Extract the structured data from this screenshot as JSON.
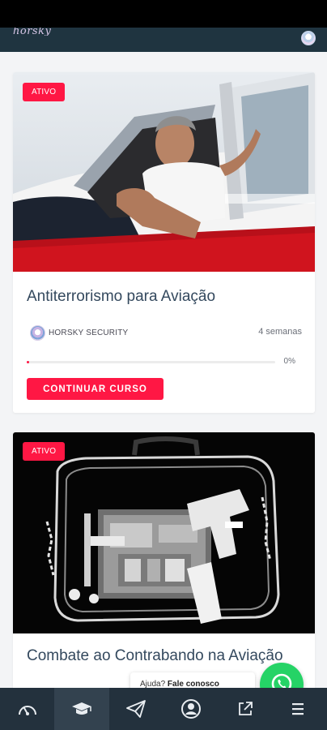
{
  "header": {
    "logo_text": "horsky"
  },
  "courses": [
    {
      "badge": "ATIVO",
      "title": "Antiterrorismo para Aviação",
      "author": "HORSKY SECURITY",
      "duration": "4 semanas",
      "progress_label": "0%",
      "progress": 0.01,
      "button_label": "CONTINUAR CURSO"
    },
    {
      "badge": "ATIVO",
      "title": "Combate ao Contrabando na Aviação"
    }
  ],
  "help": {
    "question": "Ajuda?",
    "action": "Fale conosco"
  },
  "bottom_nav": {
    "items": [
      {
        "icon": "dashboard-gauge-icon"
      },
      {
        "icon": "graduation-cap-icon",
        "active": true
      },
      {
        "icon": "paper-plane-icon"
      },
      {
        "icon": "user-circle-icon"
      },
      {
        "icon": "external-link-icon"
      },
      {
        "icon": "hamburger-menu-icon"
      }
    ]
  },
  "colors": {
    "accent": "#ff1744",
    "header_bg": "#1f3440",
    "nav_bg": "#23313d",
    "title": "#34495e",
    "whatsapp": "#25d366"
  }
}
